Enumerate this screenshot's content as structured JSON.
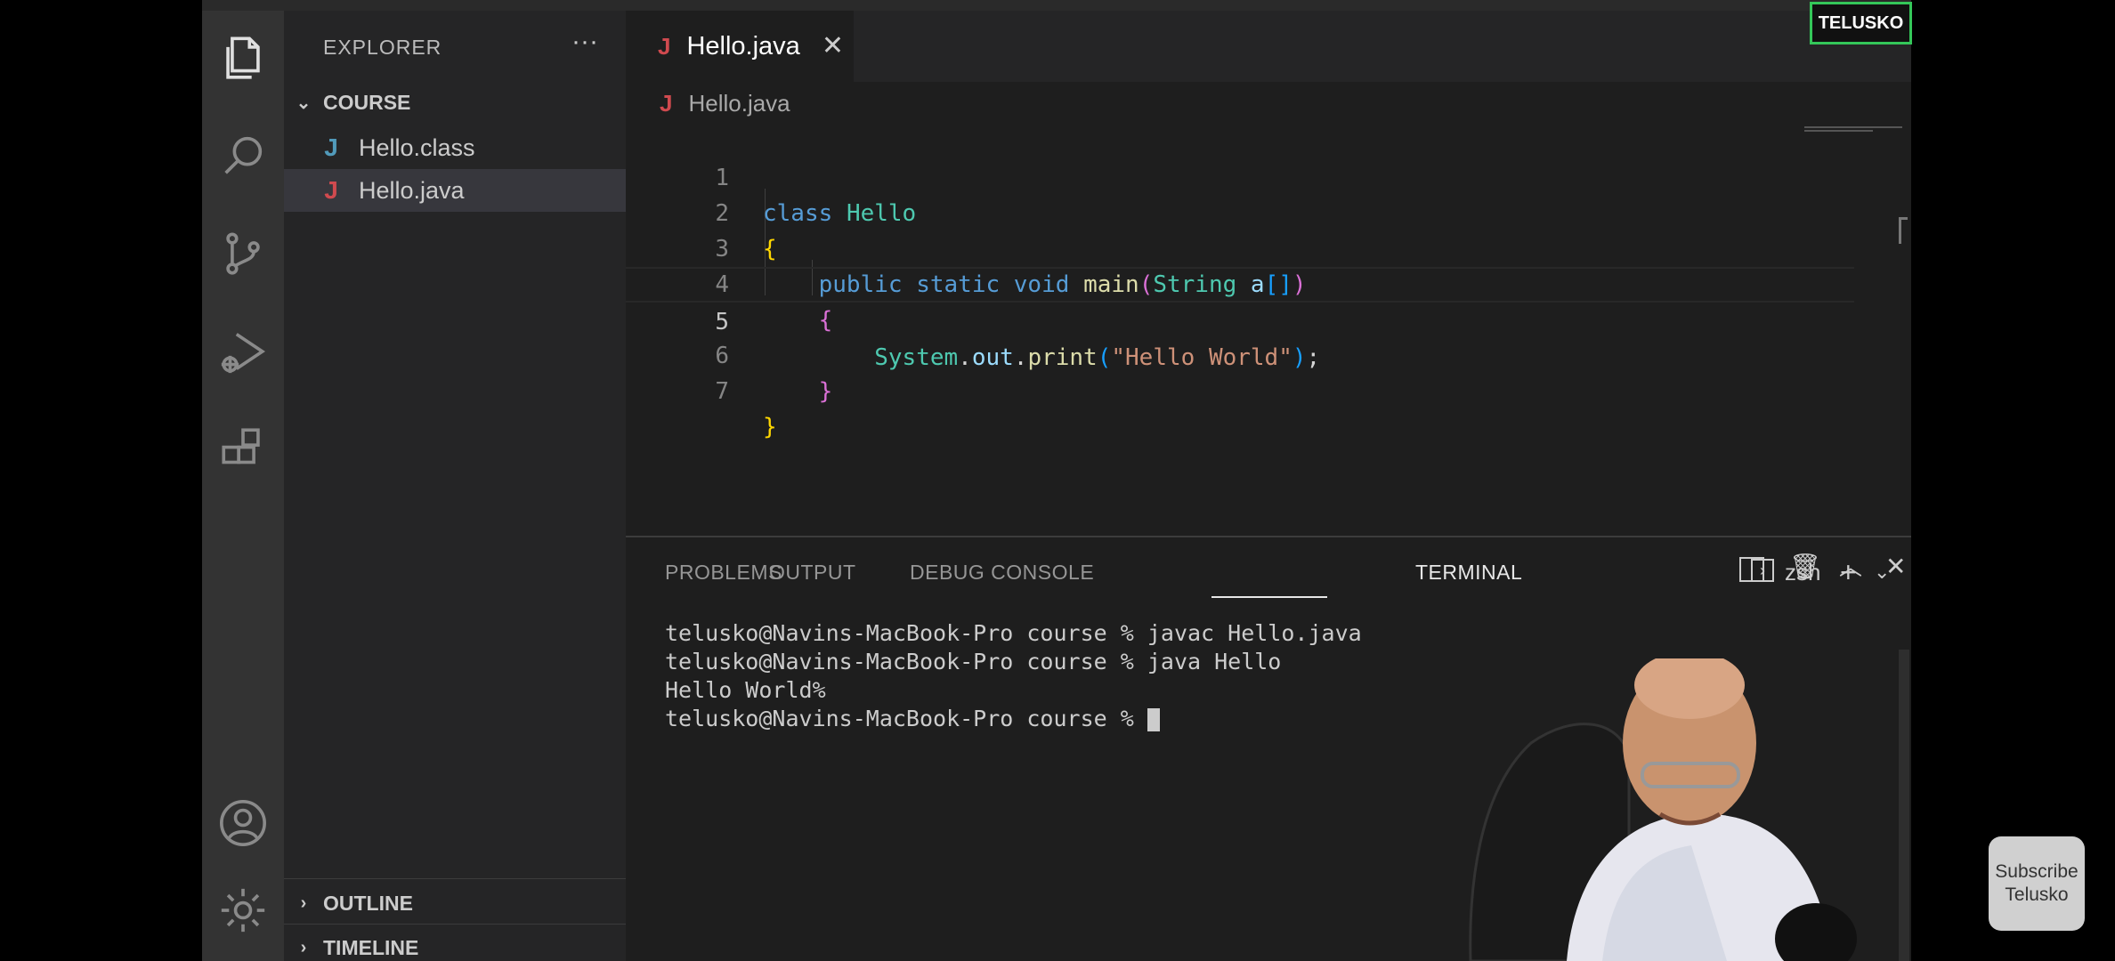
{
  "overlay": {
    "brand_badge": "TELUSKO",
    "subscribe_label": "Subscribe Telusko"
  },
  "activity_bar": {
    "icons": [
      "files-icon",
      "search-icon",
      "source-control-icon",
      "run-debug-icon",
      "extensions-icon",
      "account-icon",
      "settings-gear-icon"
    ]
  },
  "sidebar": {
    "title": "EXPLORER",
    "more_label": "···",
    "folder": {
      "name": "COURSE",
      "files": [
        {
          "icon": "J",
          "name": "Hello.class",
          "icon_color": "#519aba"
        },
        {
          "icon": "J",
          "name": "Hello.java",
          "icon_color": "#d04a4f"
        }
      ]
    },
    "outline_label": "OUTLINE",
    "timeline_label": "TIMELINE"
  },
  "editor": {
    "tab": {
      "icon": "J",
      "label": "Hello.java",
      "close": "✕"
    },
    "breadcrumb": {
      "icon": "J",
      "label": "Hello.java"
    },
    "current_line": 5,
    "lines": [
      {
        "n": "1",
        "text": "class Hello"
      },
      {
        "n": "2",
        "text": "{"
      },
      {
        "n": "3",
        "text": "    public static void main(String a[])"
      },
      {
        "n": "4",
        "text": "    {"
      },
      {
        "n": "5",
        "text": "        System.out.print(\"Hello World\");"
      },
      {
        "n": "6",
        "text": "    }"
      },
      {
        "n": "7",
        "text": "}"
      }
    ]
  },
  "panel": {
    "tabs": [
      "PROBLEMS",
      "OUTPUT",
      "DEBUG CONSOLE",
      "TERMINAL"
    ],
    "active_tab": "TERMINAL",
    "terminal_shell": "zsh",
    "terminal_lines": [
      "telusko@Navins-MacBook-Pro course % javac Hello.java",
      "telusko@Navins-MacBook-Pro course % java Hello",
      "Hello World%",
      "telusko@Navins-MacBook-Pro course % "
    ]
  },
  "colors": {
    "activity_bar": "#333333",
    "sidebar": "#252526",
    "editor_bg": "#1e1e1e",
    "java_icon": "#d04a4f",
    "class_icon": "#519aba",
    "keyword": "#569cd6",
    "type": "#4ec9b0",
    "string": "#ce9178",
    "badge_border": "#34c759"
  }
}
